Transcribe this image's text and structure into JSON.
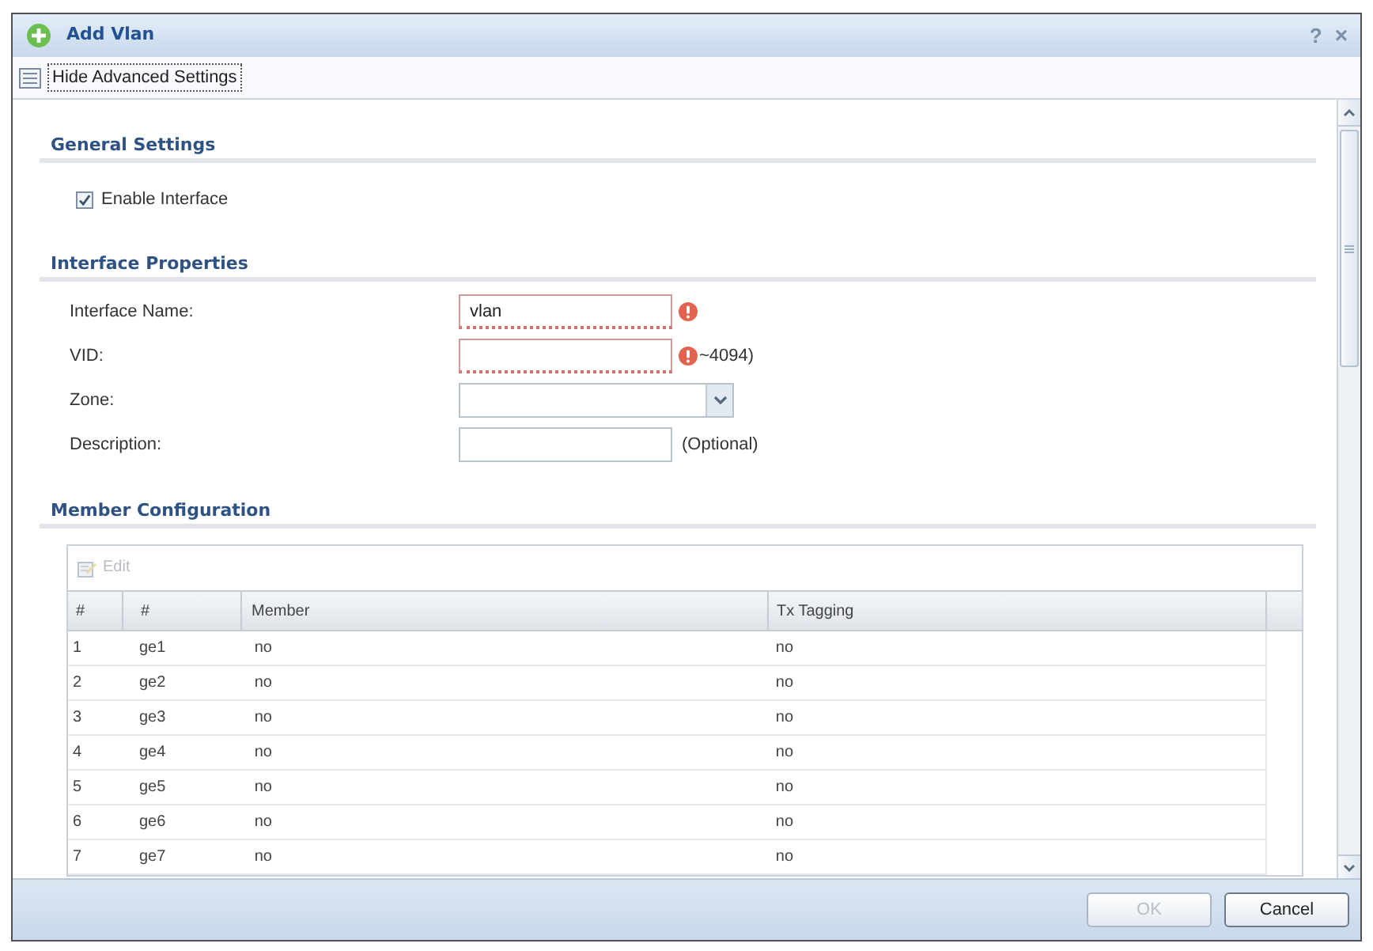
{
  "window": {
    "title": "Add Vlan",
    "help": "?",
    "close": "×"
  },
  "toolbar": {
    "toggle": {
      "label": "Hide Advanced Settings",
      "focused": true
    }
  },
  "sections": [
    {
      "kind": "checkboxes",
      "title": "General Settings",
      "items": [
        {
          "label": "Enable Interface",
          "checked": true
        }
      ]
    },
    {
      "kind": "form",
      "title": "Interface Properties",
      "fields": [
        {
          "kind": "text",
          "label": "Interface Name:",
          "value": "vlan",
          "error": true
        },
        {
          "kind": "text",
          "label": "VID:",
          "error": true,
          "note": "~4094)"
        },
        {
          "kind": "select",
          "label": "Zone:",
          "error": false
        },
        {
          "kind": "text",
          "label": "Description:",
          "error": false,
          "note": "(Optional)"
        }
      ]
    },
    {
      "kind": "table",
      "title": "Member Configuration",
      "actions": [
        {
          "label": "Edit",
          "disabled": true
        }
      ],
      "columns": [
        "#",
        "#",
        "Member",
        "Tx Tagging"
      ],
      "rows": [
        [
          "1",
          "ge1",
          "no",
          "no"
        ],
        [
          "2",
          "ge2",
          "no",
          "no"
        ],
        [
          "3",
          "ge3",
          "no",
          "no"
        ],
        [
          "4",
          "ge4",
          "no",
          "no"
        ],
        [
          "5",
          "ge5",
          "no",
          "no"
        ],
        [
          "6",
          "ge6",
          "no",
          "no"
        ],
        [
          "7",
          "ge7",
          "no",
          "no"
        ]
      ]
    }
  ],
  "buttons": [
    {
      "label": "OK",
      "disabled": true
    },
    {
      "label": "Cancel",
      "disabled": false
    }
  ]
}
